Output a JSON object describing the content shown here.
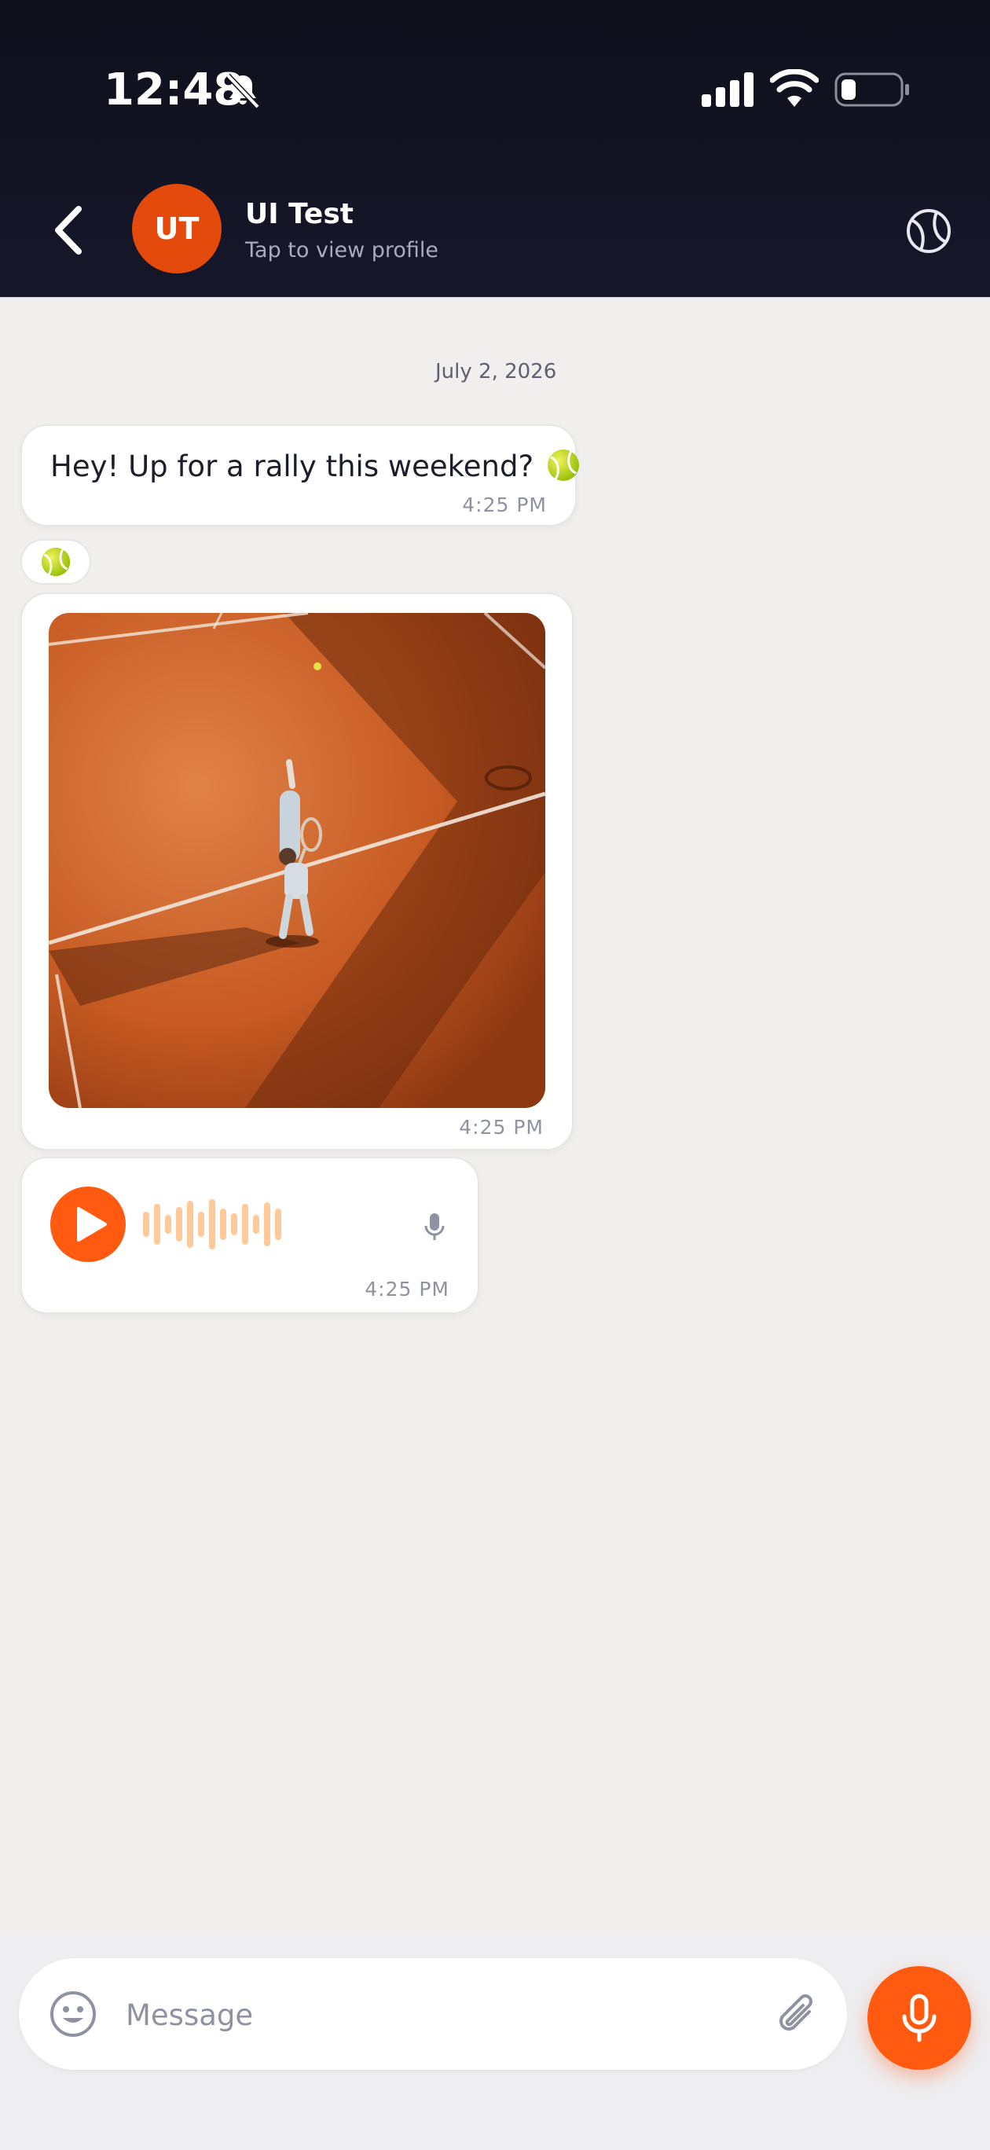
{
  "status_bar": {
    "time": "12:48"
  },
  "header": {
    "avatar_initials": "UT",
    "contact_name": "UI Test",
    "subtitle": "Tap to view profile"
  },
  "chat": {
    "date_separator": "July 2, 2026",
    "messages": [
      {
        "type": "text",
        "text": "Hey! Up for a rally this weekend?",
        "time": "4:25 PM"
      },
      {
        "type": "image",
        "time": "4:25 PM"
      },
      {
        "type": "voice",
        "time": "4:25 PM"
      }
    ]
  },
  "composer": {
    "placeholder": "Message"
  },
  "colors": {
    "accent": "#ff5a10",
    "header_bg": "#121320",
    "chat_bg": "#f0efee"
  }
}
